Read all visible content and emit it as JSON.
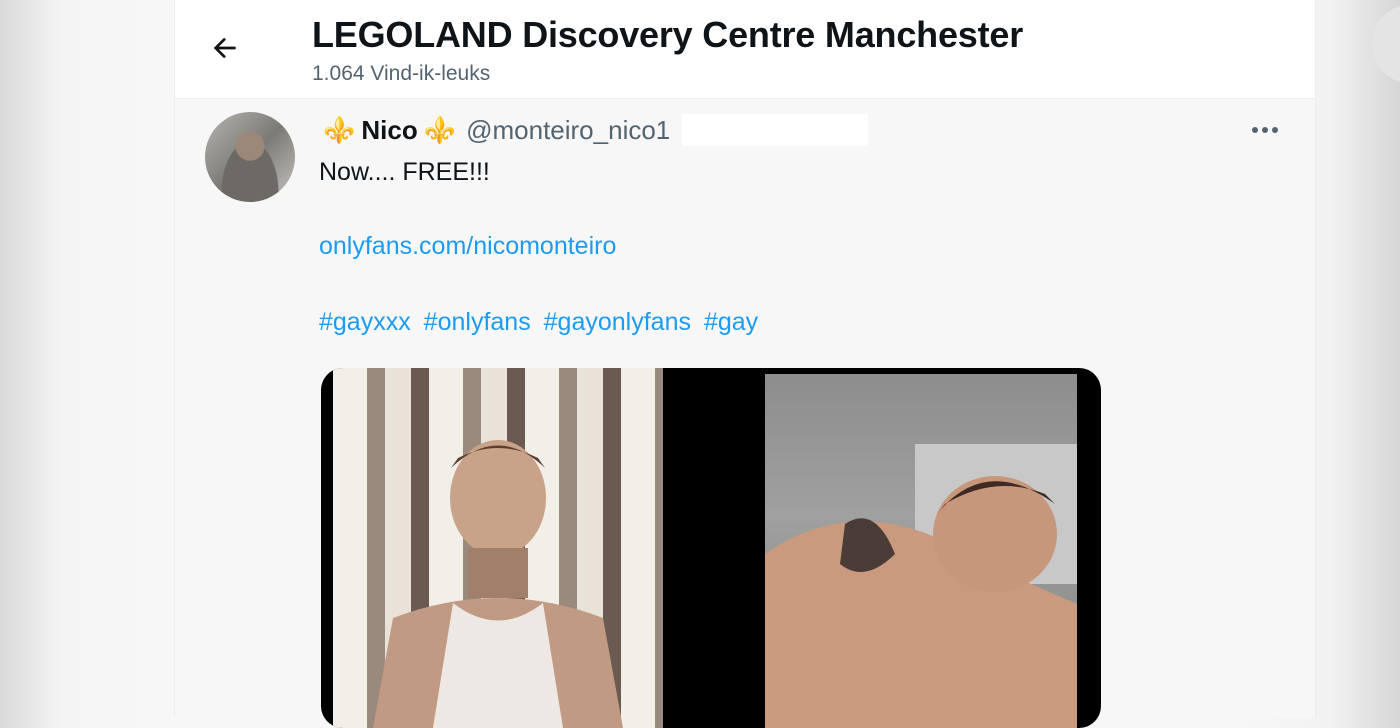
{
  "header": {
    "title": "LEGOLAND Discovery Centre Manchester",
    "subtitle": "1.064 Vind-ik-leuks"
  },
  "tweet": {
    "fleur_left": "⚜️",
    "display_name": "Nico",
    "fleur_right": "⚜️",
    "handle": "@monteiro_nico1",
    "text": "Now.... FREE!!!",
    "link": "onlyfans.com/nicomonteiro",
    "hashtags": [
      "#gayxxx",
      "#onlyfans",
      "#gayonlyfans",
      "#gay"
    ]
  },
  "icons": {
    "back": "arrow-left-icon",
    "more": "more-horizontal-icon"
  },
  "colors": {
    "link": "#1d9bf0",
    "secondary_text": "#536471",
    "fleur": "#7b3fbf"
  }
}
